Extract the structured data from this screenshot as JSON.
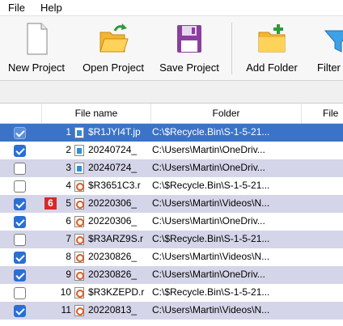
{
  "menu": {
    "file": "File",
    "help": "Help"
  },
  "toolbar": {
    "new_project": "New Project",
    "open_project": "Open Project",
    "save_project": "Save Project",
    "add_folder": "Add Folder",
    "filter": "Filter"
  },
  "columns": {
    "file_name": "File name",
    "folder": "Folder",
    "file": "File"
  },
  "badge": "6",
  "rows": [
    {
      "num": "1",
      "name": "$R1JYI4T.jp",
      "folder": "C:\\$Recycle.Bin\\S-1-5-21...",
      "checked": true,
      "icon": "jpg"
    },
    {
      "num": "2",
      "name": "20240724_",
      "folder": "C:\\Users\\Martin\\OneDriv...",
      "checked": true,
      "icon": "jpg"
    },
    {
      "num": "3",
      "name": "20240724_",
      "folder": "C:\\Users\\Martin\\OneDriv...",
      "checked": false,
      "icon": "jpg"
    },
    {
      "num": "4",
      "name": "$R3651C3.r",
      "folder": "C:\\$Recycle.Bin\\S-1-5-21...",
      "checked": false,
      "icon": "vid"
    },
    {
      "num": "5",
      "name": "20220306_",
      "folder": "C:\\Users\\Martin\\Videos\\N...",
      "checked": true,
      "icon": "vid"
    },
    {
      "num": "6",
      "name": "20220306_",
      "folder": "C:\\Users\\Martin\\OneDriv...",
      "checked": true,
      "icon": "vid"
    },
    {
      "num": "7",
      "name": "$R3ARZ9S.r",
      "folder": "C:\\$Recycle.Bin\\S-1-5-21...",
      "checked": false,
      "icon": "vid"
    },
    {
      "num": "8",
      "name": "20230826_",
      "folder": "C:\\Users\\Martin\\Videos\\N...",
      "checked": true,
      "icon": "vid"
    },
    {
      "num": "9",
      "name": "20230826_",
      "folder": "C:\\Users\\Martin\\OneDriv...",
      "checked": true,
      "icon": "vid"
    },
    {
      "num": "10",
      "name": "$R3KZEPD.r",
      "folder": "C:\\$Recycle.Bin\\S-1-5-21...",
      "checked": false,
      "icon": "vid"
    },
    {
      "num": "11",
      "name": "20220813_",
      "folder": "C:\\Users\\Martin\\Videos\\N...",
      "checked": true,
      "icon": "vid"
    }
  ]
}
